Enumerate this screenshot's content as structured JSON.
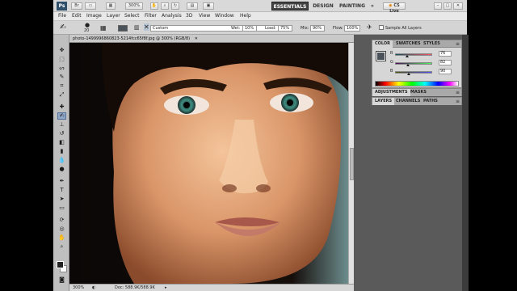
{
  "app": {
    "logo": "Ps",
    "zoom_select": "300%",
    "workspaces": [
      "ESSENTIALS",
      "DESIGN",
      "PAINTING"
    ],
    "more_workspaces": "»",
    "cs_live": "CS Live"
  },
  "menu": [
    "File",
    "Edit",
    "Image",
    "Layer",
    "Select",
    "Filter",
    "Analysis",
    "3D",
    "View",
    "Window",
    "Help"
  ],
  "options": {
    "brush_size": "20",
    "mode_value": "Custom",
    "wet_label": "Wet:",
    "wet_value": "10%",
    "load_label": "Load:",
    "load_value": "75%",
    "mix_label": "Mix:",
    "mix_value": "90%",
    "flow_label": "Flow:",
    "flow_value": "100%",
    "sample_all_layers": "Sample All Layers"
  },
  "document": {
    "tab_title": "photo-1499996860823-5214fcc65f8f.jpg @ 300% (RGB/8)",
    "status_zoom": "300%",
    "status_doc": "Doc: 588.9K/588.9K"
  },
  "color_panel": {
    "tabs": [
      "COLOR",
      "SWATCHES",
      "STYLES"
    ],
    "channels": [
      {
        "label": "R",
        "value": "76",
        "level": 0.3
      },
      {
        "label": "G",
        "value": "82",
        "level": 0.32
      },
      {
        "label": "B",
        "value": "90",
        "level": 0.35
      }
    ],
    "fg_color": "#4c525a"
  },
  "adjust_panel": {
    "tabs": [
      "ADJUSTMENTS",
      "MASKS"
    ]
  },
  "layers_panel": {
    "tabs": [
      "LAYERS",
      "CHANNELS",
      "PATHS"
    ]
  },
  "tools": [
    "move-tool",
    "marquee-tool",
    "lasso-tool",
    "quick-selection-tool",
    "crop-tool",
    "eyedropper-tool",
    "healing-brush-tool",
    "mixer-brush-tool",
    "clone-stamp-tool",
    "history-brush-tool",
    "eraser-tool",
    "gradient-tool",
    "blur-tool",
    "dodge-tool",
    "pen-tool",
    "type-tool",
    "path-selection-tool",
    "shape-tool",
    "3d-rotate-tool",
    "3d-orbit-tool",
    "hand-tool",
    "zoom-tool"
  ]
}
